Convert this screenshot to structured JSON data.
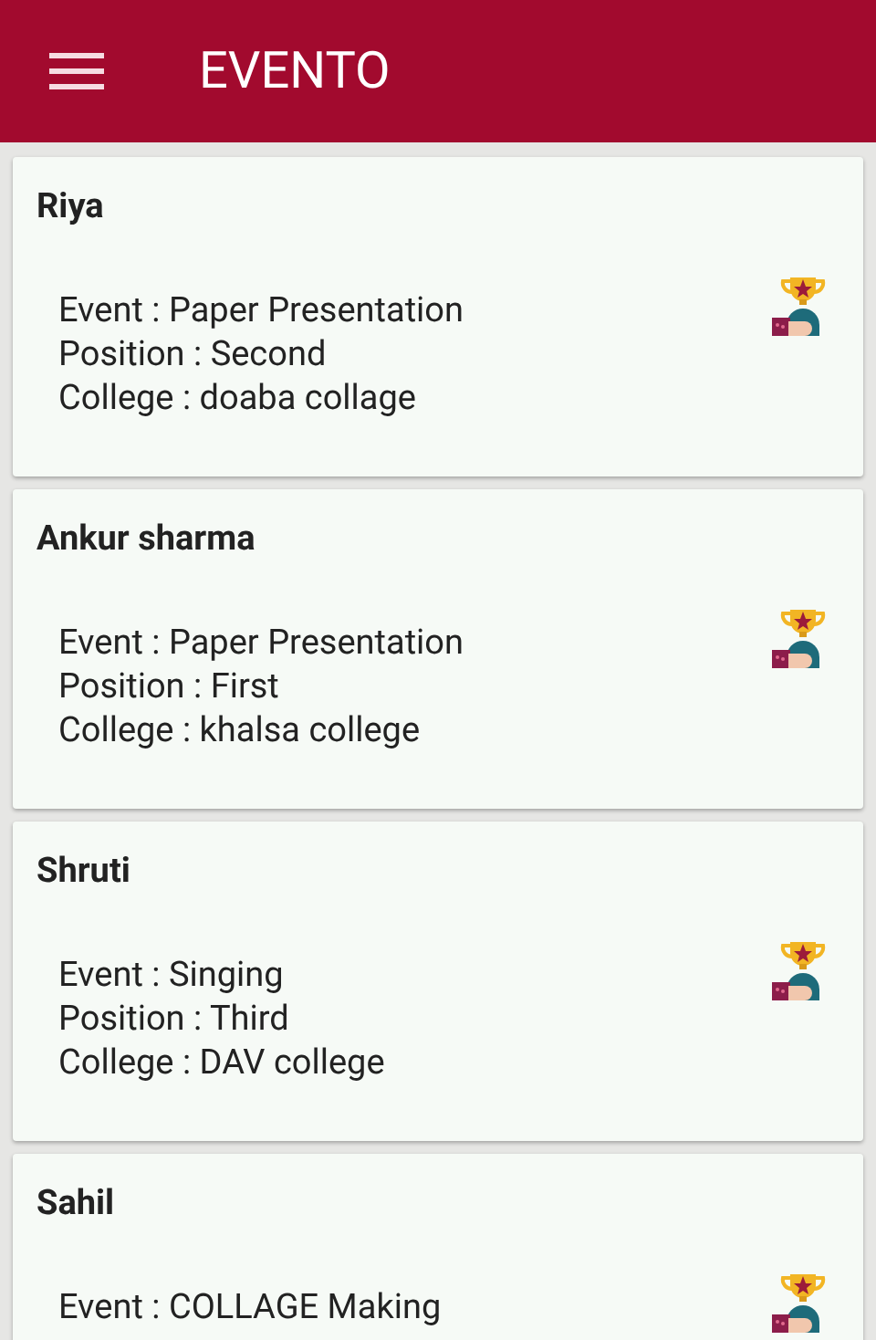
{
  "app_bar": {
    "title": "EVENTO"
  },
  "winners": [
    {
      "name": "Riya",
      "event": "Event : Paper Presentation",
      "position": "Position : Second",
      "college": "College : doaba collage"
    },
    {
      "name": "Ankur sharma",
      "event": "Event : Paper Presentation",
      "position": "Position : First",
      "college": "College : khalsa college"
    },
    {
      "name": "Shruti",
      "event": "Event : Singing",
      "position": "Position : Third",
      "college": "College : DAV college"
    },
    {
      "name": "Sahil",
      "event": "Event : COLLAGE Making"
    }
  ]
}
